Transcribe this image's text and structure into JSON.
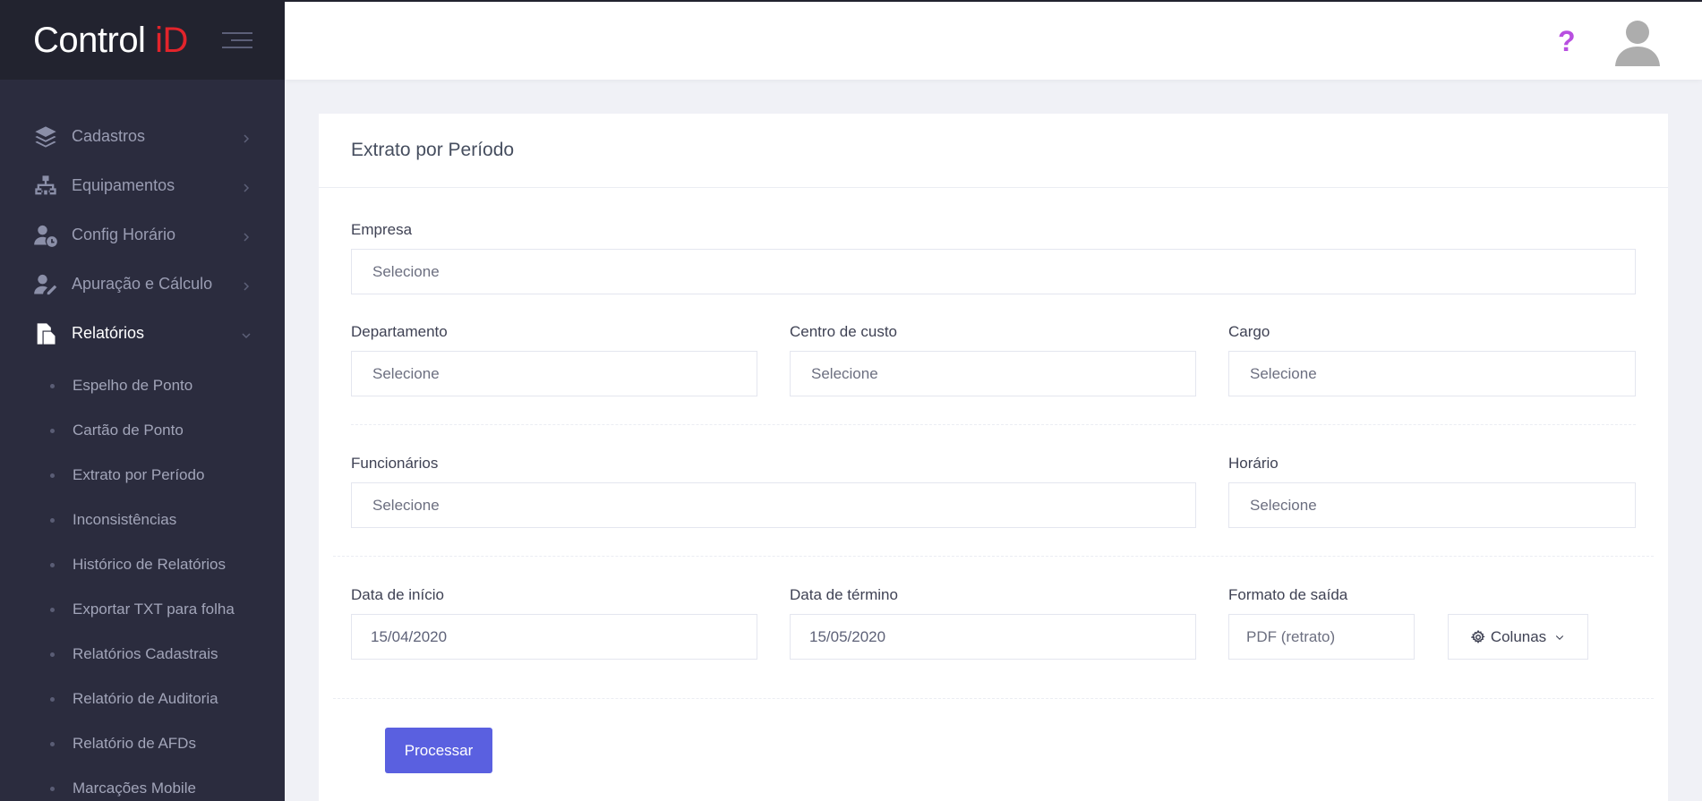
{
  "brand": {
    "logo_main": "Control ",
    "logo_accent": "iD"
  },
  "sidebar": {
    "items": [
      {
        "label": "Cadastros",
        "icon": "layers-icon"
      },
      {
        "label": "Equipamentos",
        "icon": "network-icon"
      },
      {
        "label": "Config Horário",
        "icon": "user-clock-icon"
      },
      {
        "label": "Apuração e Cálculo",
        "icon": "user-edit-icon"
      },
      {
        "label": "Relatórios",
        "icon": "documents-icon",
        "active": true
      }
    ],
    "subitems": [
      "Espelho de Ponto",
      "Cartão de Ponto",
      "Extrato por Período",
      "Inconsistências",
      "Histórico de Relatórios",
      "Exportar TXT para folha",
      "Relatórios Cadastrais",
      "Relatório de Auditoria",
      "Relatório de AFDs",
      "Marcações Mobile"
    ]
  },
  "header": {
    "help_glyph": "?"
  },
  "page": {
    "title": "Extrato por Período",
    "fields": {
      "empresa": {
        "label": "Empresa",
        "value": "Selecione"
      },
      "departamento": {
        "label": "Departamento",
        "value": "Selecione"
      },
      "centro_custo": {
        "label": "Centro de custo",
        "value": "Selecione"
      },
      "cargo": {
        "label": "Cargo",
        "value": "Selecione"
      },
      "funcionarios": {
        "label": "Funcionários",
        "value": "Selecione"
      },
      "horario": {
        "label": "Horário",
        "value": "Selecione"
      },
      "data_inicio": {
        "label": "Data de início",
        "value": "15/04/2020"
      },
      "data_termino": {
        "label": "Data de término",
        "value": "15/05/2020"
      },
      "formato_saida": {
        "label": "Formato de saída",
        "value": "PDF (retrato)"
      }
    },
    "columns_button": "Colunas",
    "process_button": "Processar"
  },
  "colors": {
    "sidebar_bg": "#2b2c3e",
    "primary": "#5a60e0",
    "help": "#b84fe0",
    "brand_accent": "#e2242b"
  }
}
